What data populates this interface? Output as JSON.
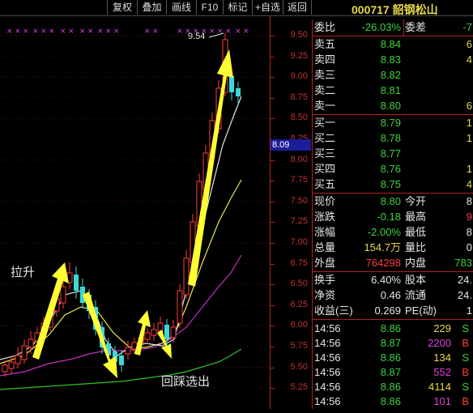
{
  "toolbar": {
    "buttons": [
      "复权",
      "叠加",
      "画线",
      "F10",
      "标记",
      "+自选",
      "返回"
    ]
  },
  "stock": {
    "code": "000717",
    "name": "韶钢松山"
  },
  "axis": {
    "labels": [
      "9.50",
      "9.25",
      "9.00",
      "8.75",
      "8.50",
      "8.25",
      "8.00",
      "7.75",
      "7.50",
      "7.25",
      "7.00",
      "6.75",
      "6.50",
      "6.25",
      "6.00",
      "5.75",
      "5.50",
      "5.25"
    ],
    "current_price_tag": "8.09"
  },
  "chart": {
    "high_label": "9.54",
    "annotation_rise": "拉升",
    "annotation_pullback": "回踩选出",
    "colors": {
      "up": "#ff3c3c",
      "down": "#3cd8d8",
      "ma_white": "#e6e6e6",
      "ma_yellow": "#e8e848",
      "ma_magenta": "#c030c0",
      "ma_green": "#30c030",
      "arrow": "#ffff33"
    }
  },
  "quote": {
    "weibi_label": "委比",
    "weibi_value": "-26.03%",
    "weicha_label": "委差",
    "weicha_value": "-7",
    "sells": [
      {
        "label": "卖五",
        "price": "8.84",
        "vol": "6"
      },
      {
        "label": "卖四",
        "price": "8.83",
        "vol": "4"
      },
      {
        "label": "卖三",
        "price": "8.82",
        "vol": ""
      },
      {
        "label": "卖二",
        "price": "8.81",
        "vol": ""
      },
      {
        "label": "卖一",
        "price": "8.80",
        "vol": "6"
      }
    ],
    "buys": [
      {
        "label": "买一",
        "price": "8.79",
        "vol": "1"
      },
      {
        "label": "买二",
        "price": "8.78",
        "vol": "1"
      },
      {
        "label": "买三",
        "price": "8.77",
        "vol": ""
      },
      {
        "label": "买四",
        "price": "8.76",
        "vol": "1"
      },
      {
        "label": "买五",
        "price": "8.75",
        "vol": "4"
      }
    ],
    "stats": [
      {
        "l1": "现价",
        "v1": "8.80",
        "l2": "今开",
        "v2": "8"
      },
      {
        "l1": "涨跌",
        "v1": "-0.18",
        "l2": "最高",
        "v2": "9"
      },
      {
        "l1": "涨幅",
        "v1": "-2.00%",
        "l2": "最低",
        "v2": "8"
      },
      {
        "l1": "总量",
        "v1": "154.7万",
        "l2": "量比",
        "v2": "0"
      },
      {
        "l1": "外盘",
        "v1": "764298",
        "l2": "内盘",
        "v2": "783"
      }
    ],
    "stats2": [
      {
        "l1": "换手",
        "v1": "6.40%",
        "l2": "股本",
        "v2": "24."
      },
      {
        "l1": "净资",
        "v1": "0.46",
        "l2": "流通",
        "v2": "24."
      },
      {
        "l1": "收益(三)",
        "v1": "0.269",
        "l2": "PE(动)",
        "v2": "1"
      }
    ],
    "ticks": [
      {
        "time": "14:56",
        "price": "8.86",
        "vol": "229",
        "side": "S"
      },
      {
        "time": "14:56",
        "price": "8.87",
        "vol": "2200",
        "side": "B"
      },
      {
        "time": "14:56",
        "price": "8.86",
        "vol": "134",
        "side": "S"
      },
      {
        "time": "14:56",
        "price": "8.87",
        "vol": "552",
        "side": "B"
      },
      {
        "time": "14:56",
        "price": "8.86",
        "vol": "4114",
        "side": "S"
      },
      {
        "time": "14:56",
        "price": "8.86",
        "vol": "101",
        "side": "B"
      }
    ]
  }
}
